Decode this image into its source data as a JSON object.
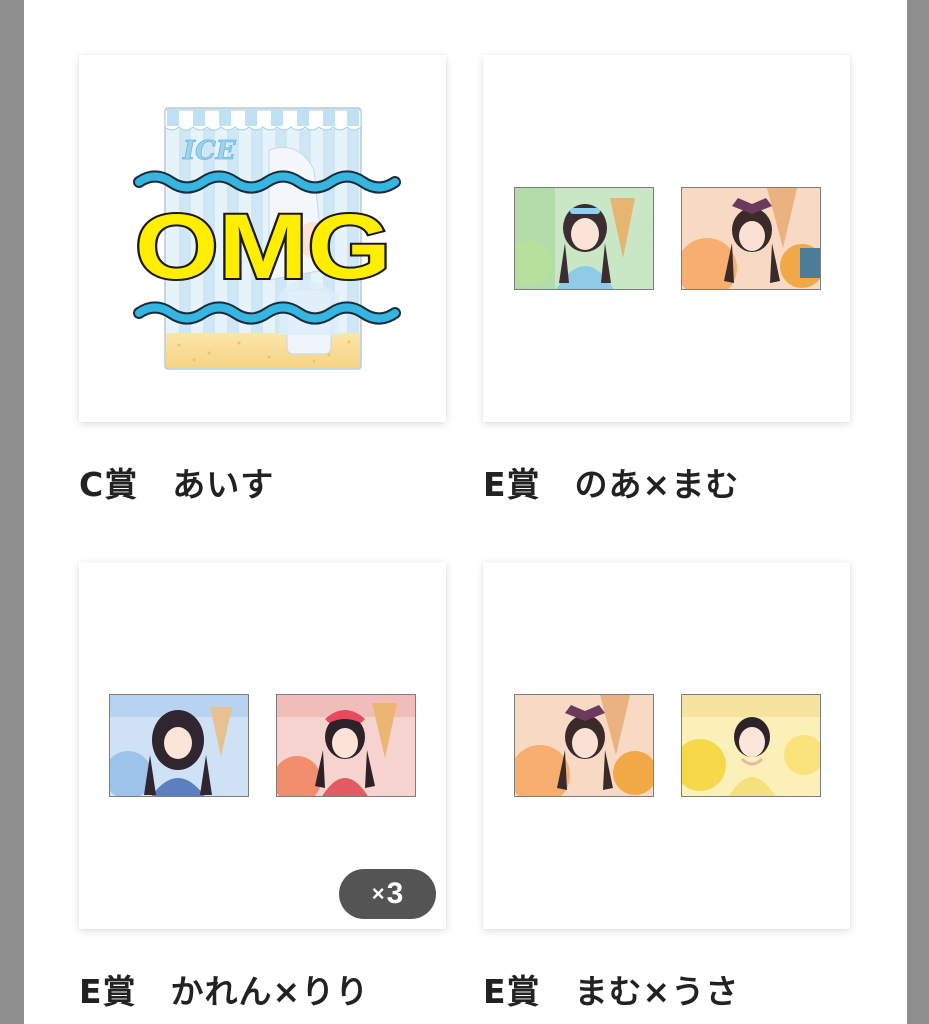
{
  "items": [
    {
      "label": "C賞　あいす",
      "overlay_text": "OMG",
      "stand_logo": "ICE"
    },
    {
      "label": "E賞　のあ×まむ"
    },
    {
      "label": "E賞　かれん×りり",
      "badge": {
        "x": "×",
        "count": "3"
      }
    },
    {
      "label": "E賞　まむ×うさ"
    }
  ],
  "colors": {
    "page_bg": "#ffffff",
    "frame_bg": "#8f8f8f",
    "omg_fill": "#ffee00",
    "wave": "#35b6e0",
    "badge_bg": "#3c3c3c"
  },
  "icons": [
    "acrylic-stand-image",
    "photo-card-image"
  ]
}
